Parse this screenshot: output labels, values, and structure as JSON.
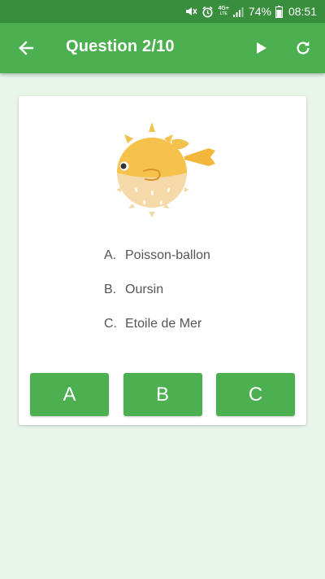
{
  "status_bar": {
    "network_label_top": "4G+",
    "network_label_bottom": "LTE",
    "battery_text": "74%",
    "time": "08:51"
  },
  "app_bar": {
    "title": "Question 2/10",
    "back_icon": "arrow-left-icon",
    "play_icon": "play-icon",
    "refresh_icon": "refresh-icon"
  },
  "question": {
    "image": "pufferfish-illustration",
    "choices": [
      {
        "letter": "A.",
        "text": "Poisson-ballon"
      },
      {
        "letter": "B.",
        "text": "Oursin"
      },
      {
        "letter": "C.",
        "text": "Etoile de Mer"
      }
    ]
  },
  "answers": {
    "a_label": "A",
    "b_label": "B",
    "c_label": "C"
  },
  "colors": {
    "status_bar": "#388E3C",
    "app_bar": "#4CAF50",
    "background": "#E8F5E9",
    "button": "#4CAF50"
  }
}
